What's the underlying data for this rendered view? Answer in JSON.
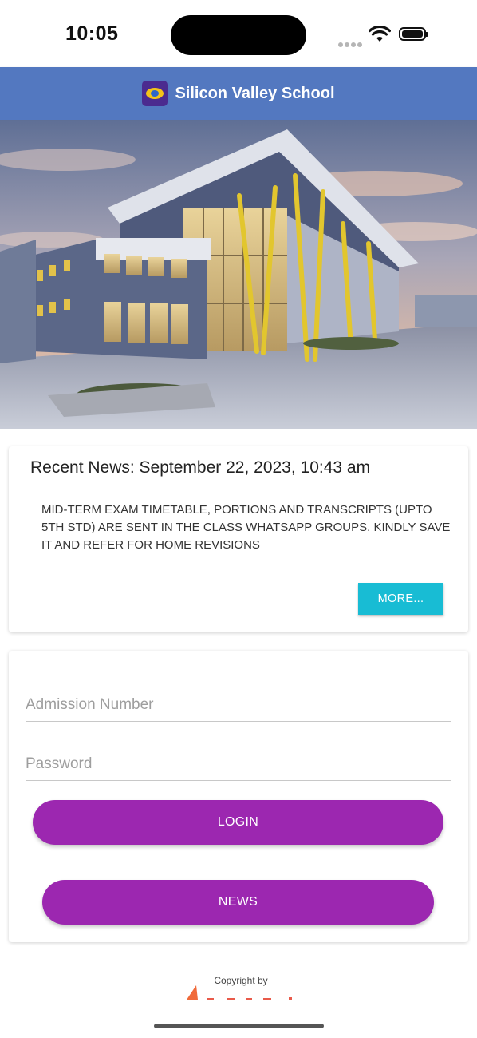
{
  "status_bar": {
    "time": "10:05"
  },
  "app_bar": {
    "title": "Silicon Valley School"
  },
  "news": {
    "heading": "Recent News: September 22, 2023, 10:43 am",
    "body": "MID-TERM EXAM TIMETABLE, PORTIONS AND TRANSCRIPTS (UPTO 5TH STD) ARE SENT IN THE CLASS WHATSAPP GROUPS. KINDLY SAVE IT AND REFER FOR HOME REVISIONS",
    "more_label": "MORE..."
  },
  "login": {
    "admission_placeholder": "Admission Number",
    "admission_value": "",
    "password_placeholder": "Password",
    "password_value": "",
    "login_label": "LOGIN",
    "news_label": "NEWS"
  },
  "footer": {
    "copyright": "Copyright by"
  },
  "colors": {
    "app_bar": "#5378c0",
    "primary_button": "#9c27b0",
    "more_button": "#18bcd4"
  },
  "icons": {
    "signal": "signal-dots-icon",
    "wifi": "wifi-icon",
    "battery": "battery-icon",
    "logo": "school-logo"
  }
}
